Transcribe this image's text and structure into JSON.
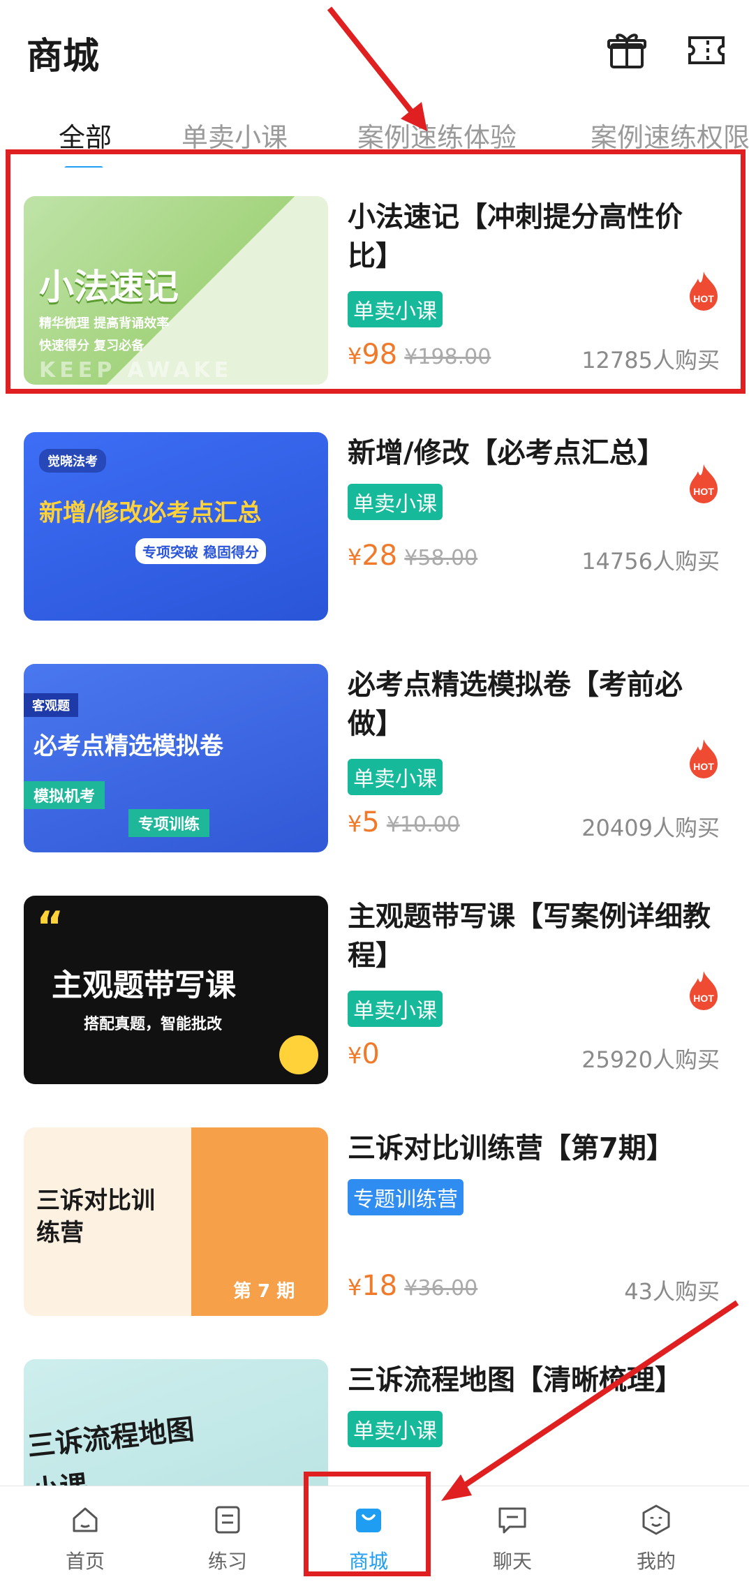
{
  "header": {
    "title": "商城",
    "icons": [
      "gift-icon",
      "ticket-icon"
    ]
  },
  "tabs": [
    {
      "label": "全部",
      "active": true
    },
    {
      "label": "单卖小课"
    },
    {
      "label": "案例速练体验"
    },
    {
      "label": "案例速练权限"
    }
  ],
  "products": [
    {
      "title": "小法速记【冲刺提分高性价比】",
      "tag": "单卖小课",
      "price": "98",
      "original_price": "¥198.00",
      "sold": "12785人购买",
      "hot": true,
      "thumb": {
        "headline": "小法速记",
        "sub1": "精华梳理 提高背诵效率",
        "sub2": "快速得分 复习必备",
        "banner": "KEEP AWAKE"
      }
    },
    {
      "title": "新增/修改【必考点汇总】",
      "tag": "单卖小课",
      "price": "28",
      "original_price": "¥58.00",
      "sold": "14756人购买",
      "hot": true,
      "thumb": {
        "badge": "觉晓法考",
        "headline": "新增/修改必考点汇总",
        "sub": "专项突破 稳固得分"
      }
    },
    {
      "title": "必考点精选模拟卷【考前必做】",
      "tag": "单卖小课",
      "price": "5",
      "original_price": "¥10.00",
      "sold": "20409人购买",
      "hot": true,
      "thumb": {
        "badge": "客观题",
        "headline": "必考点精选模拟卷",
        "sub1": "模拟机考",
        "sub2": "专项训练"
      }
    },
    {
      "title": "主观题带写课【写案例详细教程】",
      "tag": "单卖小课",
      "price": "0",
      "original_price": "",
      "sold": "25920人购买",
      "hot": true,
      "thumb": {
        "headline": "主观题带写课",
        "sub": "搭配真题，智能批改"
      }
    },
    {
      "title": "三诉对比训练营【第7期】",
      "tag": "专题训练营",
      "price": "18",
      "original_price": "¥36.00",
      "sold": "43人购买",
      "hot": false,
      "thumb": {
        "headline": "三诉对比训练营",
        "issue": "第 7 期"
      }
    },
    {
      "title": "三诉流程地图【清晰梳理】",
      "tag": "单卖小课",
      "price": "",
      "original_price": "",
      "sold": "",
      "hot": false,
      "thumb": {
        "headline": "三诉流程地图小课"
      }
    }
  ],
  "nav": [
    {
      "label": "首页",
      "icon": "home-icon"
    },
    {
      "label": "练习",
      "icon": "exercise-icon"
    },
    {
      "label": "商城",
      "icon": "shop-bag-icon",
      "active": true
    },
    {
      "label": "聊天",
      "icon": "chat-icon"
    },
    {
      "label": "我的",
      "icon": "profile-icon"
    }
  ],
  "colors": {
    "accent": "#1e9df2",
    "price": "#f07a2a",
    "tag_green": "#16b99a",
    "tag_blue": "#2f8cf0",
    "highlight": "#e02020"
  }
}
